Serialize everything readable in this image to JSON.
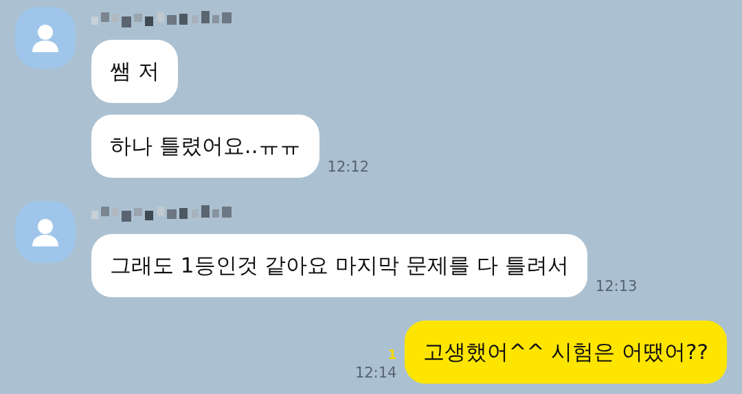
{
  "messages": [
    {
      "kind": "incoming",
      "name_blurred": true,
      "bubbles": [
        {
          "text": "쌤 저"
        },
        {
          "text": "하나 틀렸어요..ㅠㅠ",
          "time": "12:12"
        }
      ]
    },
    {
      "kind": "incoming",
      "name_blurred": true,
      "bubbles": [
        {
          "text": "그래도 1등인것 같아요 마지막 문제를 다 틀려서",
          "time": "12:13"
        }
      ]
    },
    {
      "kind": "outgoing",
      "bubbles": [
        {
          "text": "고생했어^^ 시험은 어땠어??",
          "time": "12:14",
          "unread": "1"
        }
      ]
    }
  ]
}
